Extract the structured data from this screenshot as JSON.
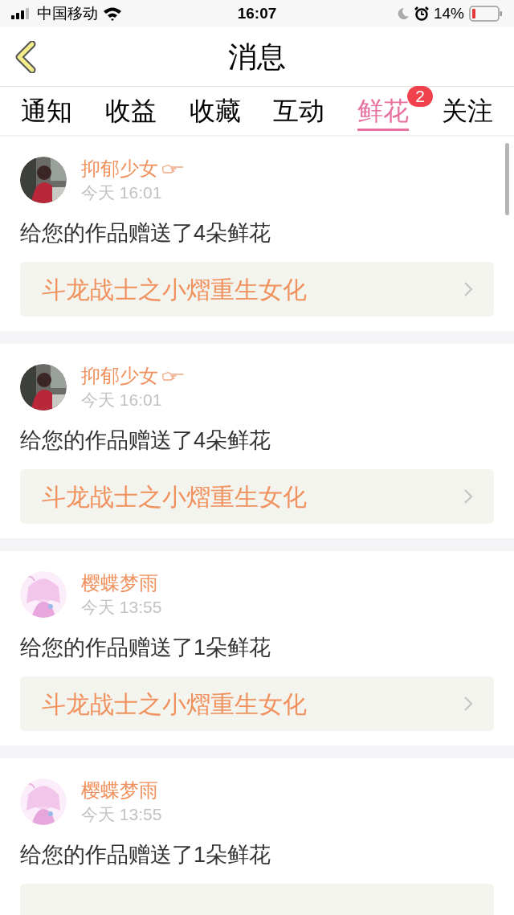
{
  "status_bar": {
    "carrier": "中国移动",
    "time": "16:07",
    "battery": "14%"
  },
  "header": {
    "title": "消息"
  },
  "tabs": [
    {
      "label": "通知",
      "selected": false
    },
    {
      "label": "收益",
      "selected": false
    },
    {
      "label": "收藏",
      "selected": false
    },
    {
      "label": "互动",
      "selected": false
    },
    {
      "label": "鲜花",
      "selected": true,
      "badge": "2"
    },
    {
      "label": "关注",
      "selected": false
    }
  ],
  "messages": [
    {
      "user": "抑郁少女",
      "pointing_hand": true,
      "time": "今天 16:01",
      "text": "给您的作品赠送了4朵鲜花",
      "work": "斗龙战士之小熠重生女化"
    },
    {
      "user": "抑郁少女",
      "pointing_hand": true,
      "time": "今天 16:01",
      "text": "给您的作品赠送了4朵鲜花",
      "work": "斗龙战士之小熠重生女化"
    },
    {
      "user": "樱蝶梦雨",
      "pointing_hand": false,
      "time": "今天 13:55",
      "text": "给您的作品赠送了1朵鲜花",
      "work": "斗龙战士之小熠重生女化"
    },
    {
      "user": "樱蝶梦雨",
      "pointing_hand": false,
      "time": "今天 13:55",
      "text": "给您的作品赠送了1朵鲜花"
    }
  ]
}
